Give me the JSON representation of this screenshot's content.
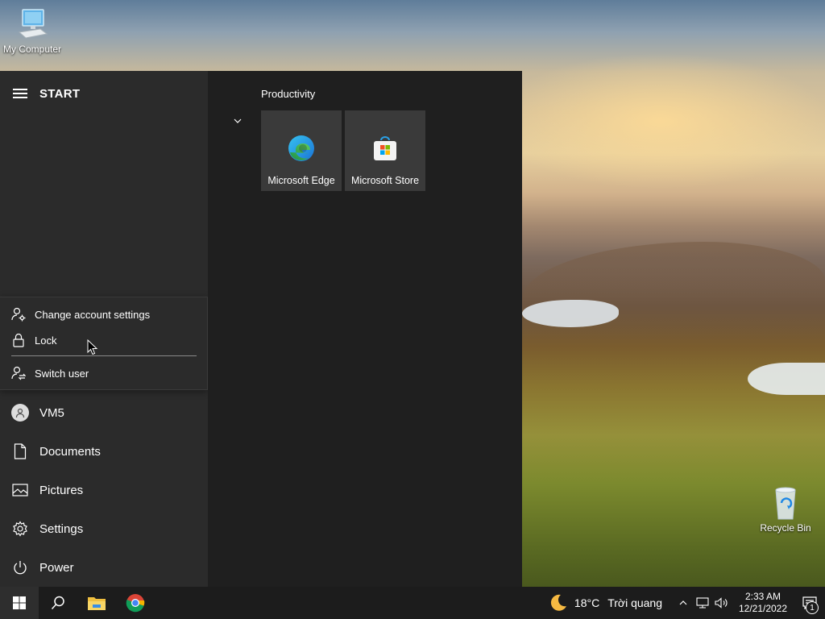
{
  "desktop": {
    "icons": {
      "my_computer": "My Computer",
      "recycle_bin": "Recycle Bin"
    }
  },
  "start_menu": {
    "title": "START",
    "account_flyout": {
      "change_account_settings": "Change account settings",
      "lock": "Lock",
      "switch_user": "Switch user"
    },
    "rail": {
      "user": "VM5",
      "documents": "Documents",
      "pictures": "Pictures",
      "settings": "Settings",
      "power": "Power"
    },
    "group": {
      "title": "Productivity",
      "tiles": {
        "edge": "Microsoft Edge",
        "store": "Microsoft Store"
      }
    }
  },
  "taskbar": {
    "weather": {
      "temperature": "18°C",
      "condition": "Trời quang"
    },
    "clock": {
      "time": "2:33 AM",
      "date": "12/21/2022"
    },
    "notification_count": "1"
  },
  "colors": {
    "start_left": "#2b2b2b",
    "start_tiles": "#1f1f1f",
    "tile": "#3a3a3a",
    "taskbar": "#1c1c1c",
    "accent_blue": "#0078d4"
  }
}
